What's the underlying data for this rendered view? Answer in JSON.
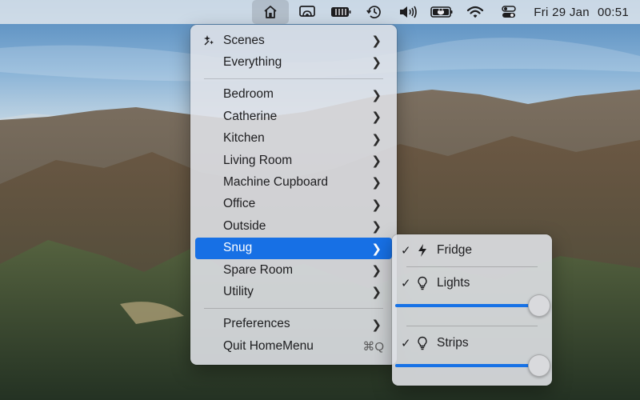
{
  "menubar": {
    "icons": [
      "home-icon",
      "airplay-icon",
      "battery-icon",
      "time-machine-icon",
      "volume-icon",
      "power-icon",
      "wifi-icon",
      "control-center-icon"
    ],
    "date": "Fri 29 Jan",
    "time": "00:51"
  },
  "menu": {
    "scenes": "Scenes",
    "everything": "Everything",
    "rooms": [
      "Bedroom",
      "Catherine",
      "Kitchen",
      "Living Room",
      "Machine Cupboard",
      "Office",
      "Outside",
      "Snug",
      "Spare Room",
      "Utility"
    ],
    "selected_room": "Snug",
    "preferences": "Preferences",
    "quit": "Quit HomeMenu",
    "quit_shortcut": "⌘Q"
  },
  "submenu": {
    "items": [
      {
        "label": "Fridge",
        "checked": true,
        "icon": "bolt-icon"
      },
      {
        "label": "Lights",
        "checked": true,
        "icon": "bulb-icon",
        "brightness": 1.0
      },
      {
        "label": "Strips",
        "checked": true,
        "icon": "bulb-icon",
        "brightness": 1.0
      }
    ],
    "check_mark": "✓"
  },
  "colors": {
    "accent": "#1770e5",
    "menu_bg": "#e0e2e8"
  }
}
